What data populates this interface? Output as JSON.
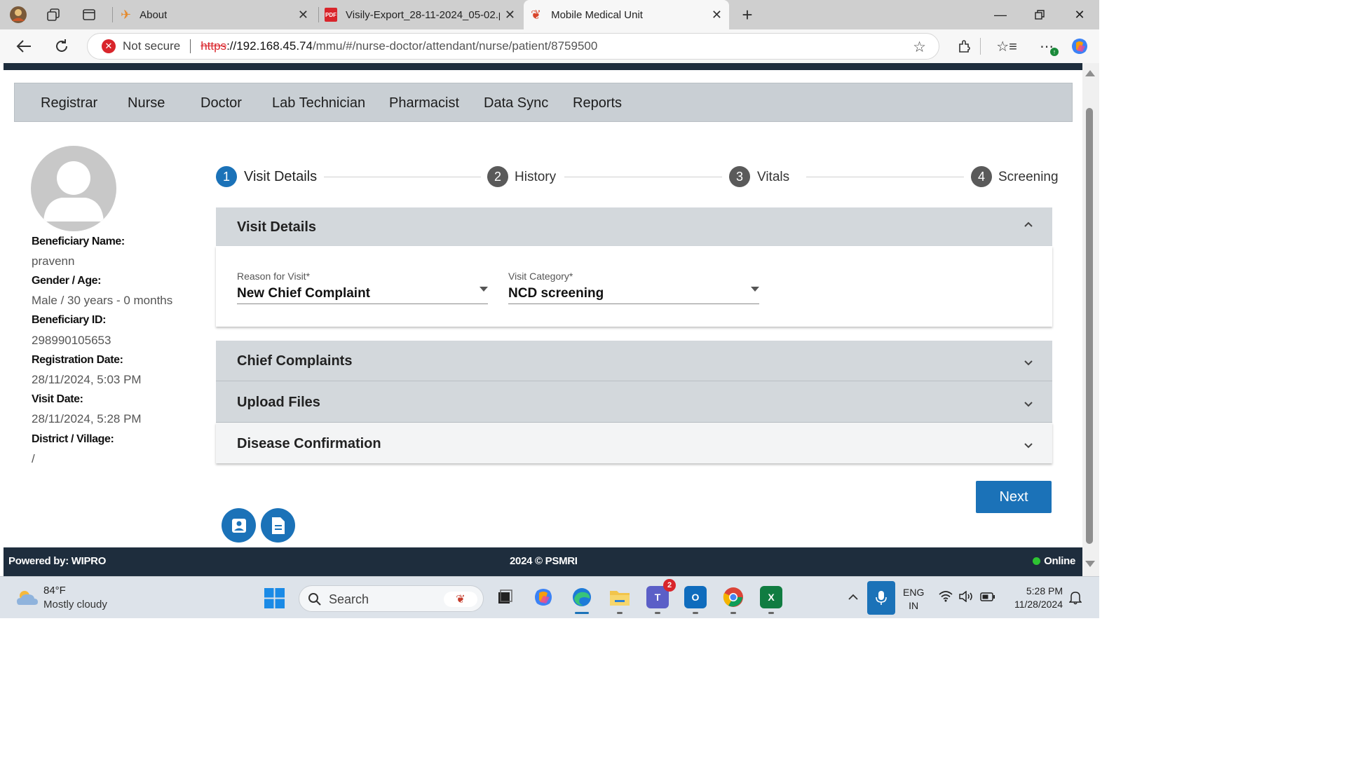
{
  "browser": {
    "tabs": [
      {
        "title": "About",
        "active": false
      },
      {
        "title": "Visily-Export_28-11-2024_05-02.p",
        "active": false
      },
      {
        "title": "Mobile Medical Unit",
        "active": true
      }
    ],
    "new_tab": "+",
    "security_label": "Not secure",
    "url_scheme": "https",
    "url_host": "://192.168.45.74",
    "url_path": "/mmu/#/nurse-doctor/attendant/nurse/patient/8759500"
  },
  "menu": {
    "items": [
      "Registrar",
      "Nurse",
      "Doctor",
      "Lab Technician",
      "Pharmacist",
      "Data Sync",
      "Reports"
    ]
  },
  "beneficiary": {
    "name_label": "Beneficiary Name:",
    "name": "pravenn",
    "gender_age_label": "Gender / Age:",
    "gender_age": "Male / 30 years - 0 months",
    "id_label": "Beneficiary ID:",
    "id": "298990105653",
    "registration_date_label": "Registration Date:",
    "registration_date": "28/11/2024, 5:03 PM",
    "visit_date_label": "Visit Date:",
    "visit_date": "28/11/2024, 5:28 PM",
    "district_label": "District / Village:",
    "district": "/"
  },
  "stepper": {
    "steps": [
      {
        "number": "1",
        "label": "Visit Details",
        "active": true
      },
      {
        "number": "2",
        "label": "History",
        "active": false
      },
      {
        "number": "3",
        "label": "Vitals",
        "active": false
      },
      {
        "number": "4",
        "label": "Screening",
        "active": false
      }
    ]
  },
  "visit_details": {
    "title": "Visit Details",
    "reason_label": "Reason for Visit*",
    "reason_value": "New Chief Complaint",
    "category_label": "Visit Category*",
    "category_value": "NCD screening"
  },
  "sections": {
    "chief_complaints": "Chief Complaints",
    "upload_files": "Upload Files",
    "disease_confirmation": "Disease Confirmation"
  },
  "actions": {
    "next": "Next"
  },
  "footer": {
    "powered_by": "Powered by: WIPRO",
    "copyright": "2024 © PSMRI",
    "status": "Online"
  },
  "taskbar": {
    "weather_temp": "84°F",
    "weather_desc": "Mostly cloudy",
    "search_placeholder": "Search",
    "teams_badge": "2",
    "lang_line1": "ENG",
    "lang_line2": "IN",
    "time": "5:28 PM",
    "date": "11/28/2024"
  },
  "colors": {
    "accent": "#1b72b8",
    "header_dark": "#1e2d3d",
    "online": "#2ec432"
  }
}
